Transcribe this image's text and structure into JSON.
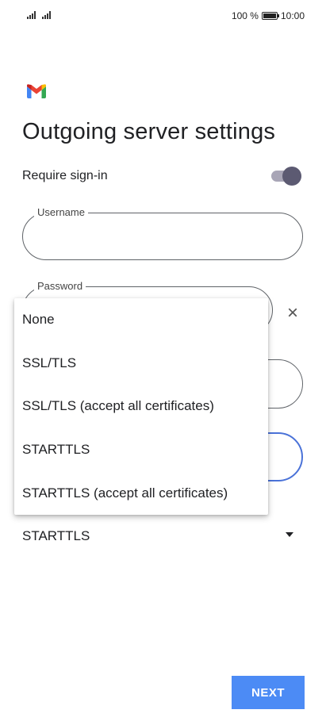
{
  "status_bar": {
    "battery_percent": "100 %",
    "time": "10:00"
  },
  "icons": {
    "logo": "gmail-logo-icon",
    "clear": "close-icon",
    "dropdown": "caret-down-icon"
  },
  "colors": {
    "primary": "#4c8bf5",
    "toggle_on": "#5c5a72",
    "focus_border": "#4a72d8"
  },
  "page": {
    "title": "Outgoing server settings"
  },
  "require_signin": {
    "label": "Require sign-in",
    "enabled": true
  },
  "username": {
    "label": "Username",
    "value": ""
  },
  "password": {
    "label": "Password",
    "value": ""
  },
  "security_type": {
    "selected": "STARTTLS",
    "options": [
      "None",
      "SSL/TLS",
      "SSL/TLS (accept all certificates)",
      "STARTTLS",
      "STARTTLS (accept all certificates)"
    ]
  },
  "actions": {
    "next_label": "NEXT"
  }
}
